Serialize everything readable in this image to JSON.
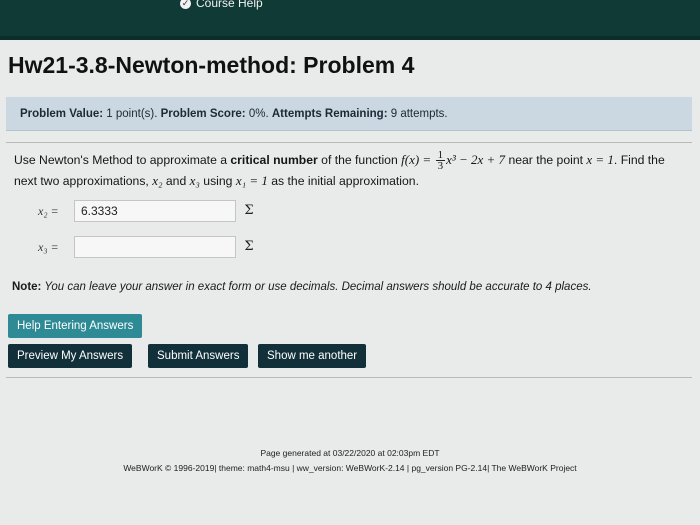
{
  "topnav": {
    "first_link": "",
    "help_label": "Course Help"
  },
  "page": {
    "title": "Hw21-3.8-Newton-method: Problem 4"
  },
  "info": {
    "value_label": "Problem Value:",
    "value_text": "1 point(s).",
    "score_label": "Problem Score:",
    "score_text": "0%.",
    "attempts_label": "Attempts Remaining:",
    "attempts_text": "9 attempts."
  },
  "problem": {
    "t1": "Use Newton's Method to approximate a ",
    "critical": "critical number",
    "t2": " of the function ",
    "f_lhs": "f(x) =",
    "frac_num": "1",
    "frac_den": "3",
    "f_rhs": "x³ − 2x + 7",
    "t3": " near the point ",
    "point": "x = 1",
    "t4": ". Find the next two approximations, ",
    "x2": "x₂",
    "t5": " and ",
    "x3": "x₃",
    "t6": " using ",
    "x1eq": "x₁ = 1",
    "t7": " as the initial approximation."
  },
  "answers": {
    "x2_label": "x₂ =",
    "x2_value": "6.3333",
    "x3_label": "x₃ =",
    "x3_value": "",
    "sigma": "Σ"
  },
  "note": {
    "label": "Note:",
    "text": " You can leave your answer in exact form or use decimals. Decimal answers should be accurate to 4 places."
  },
  "buttons": {
    "help": "Help Entering Answers",
    "preview": "Preview My Answers",
    "submit": "Submit Answers",
    "show": "Show me another"
  },
  "footer": {
    "generated": "Page generated at 03/22/2020 at 02:03pm EDT",
    "credits": "WeBWorK © 1996-2019| theme: math4-msu | ww_version: WeBWorK-2.14 | pg_version PG-2.14| The WeBWorK Project"
  },
  "colors": {
    "topbar": "#0f3a35",
    "infobar": "#cbd8e2",
    "help_button": "#2e8a95",
    "dark_button": "#12303a"
  }
}
